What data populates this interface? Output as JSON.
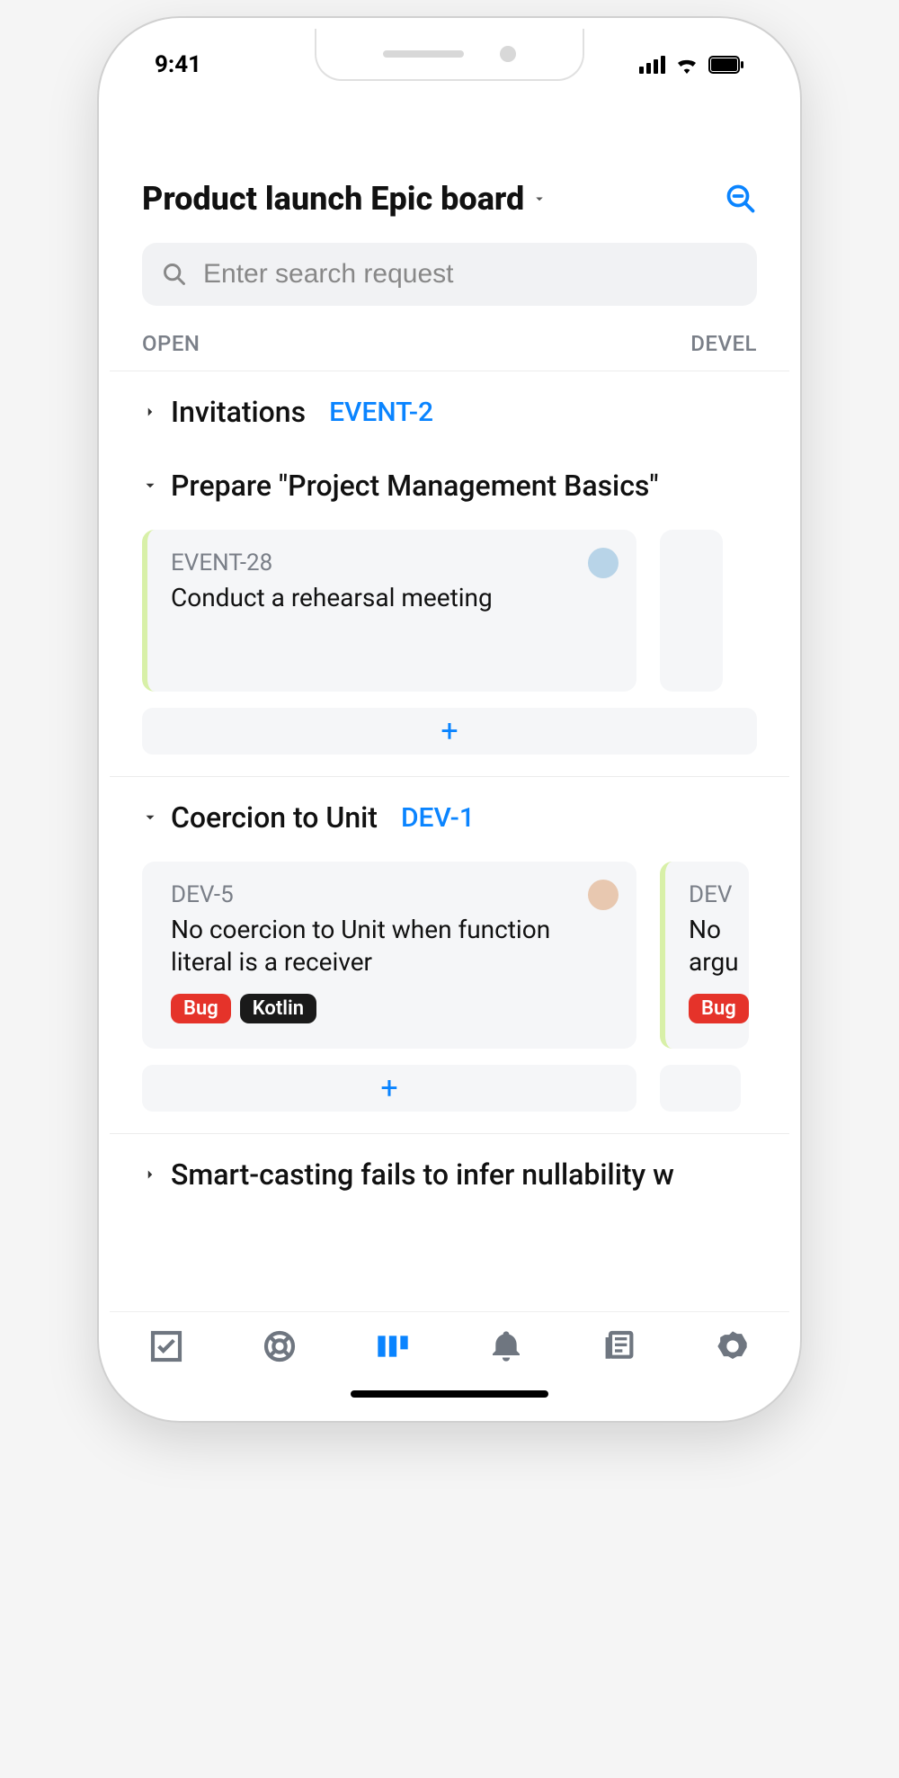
{
  "status": {
    "time": "9:41"
  },
  "header": {
    "title": "Product launch Epic board"
  },
  "search": {
    "placeholder": "Enter search request"
  },
  "tabs": {
    "left": "OPEN",
    "right": "DEVEL"
  },
  "sections": [
    {
      "collapsed": true,
      "title": "Invitations",
      "code": "EVENT-2"
    },
    {
      "collapsed": false,
      "title": "Prepare \"Project Management Basics\"",
      "code": "",
      "cards": [
        {
          "code": "EVENT-28",
          "title": "Conduct a rehearsal meeting",
          "avatar": "a1",
          "accent": "green",
          "tags": []
        }
      ]
    },
    {
      "collapsed": false,
      "title": "Coercion to Unit",
      "code": "DEV-1",
      "cards": [
        {
          "code": "DEV-5",
          "title": "No coercion to Unit when function literal is a receiver",
          "avatar": "a2",
          "accent": "",
          "tags": [
            {
              "label": "Bug",
              "cls": "red"
            },
            {
              "label": "Kotlin",
              "cls": "black"
            }
          ]
        },
        {
          "code": "DEV",
          "title": "No argu",
          "avatar": "",
          "accent": "green",
          "tags": [
            {
              "label": "Bug",
              "cls": "red"
            }
          ]
        }
      ]
    },
    {
      "collapsed": true,
      "title": "Smart-casting fails to infer nullability w",
      "code": ""
    }
  ],
  "add_label": "+"
}
